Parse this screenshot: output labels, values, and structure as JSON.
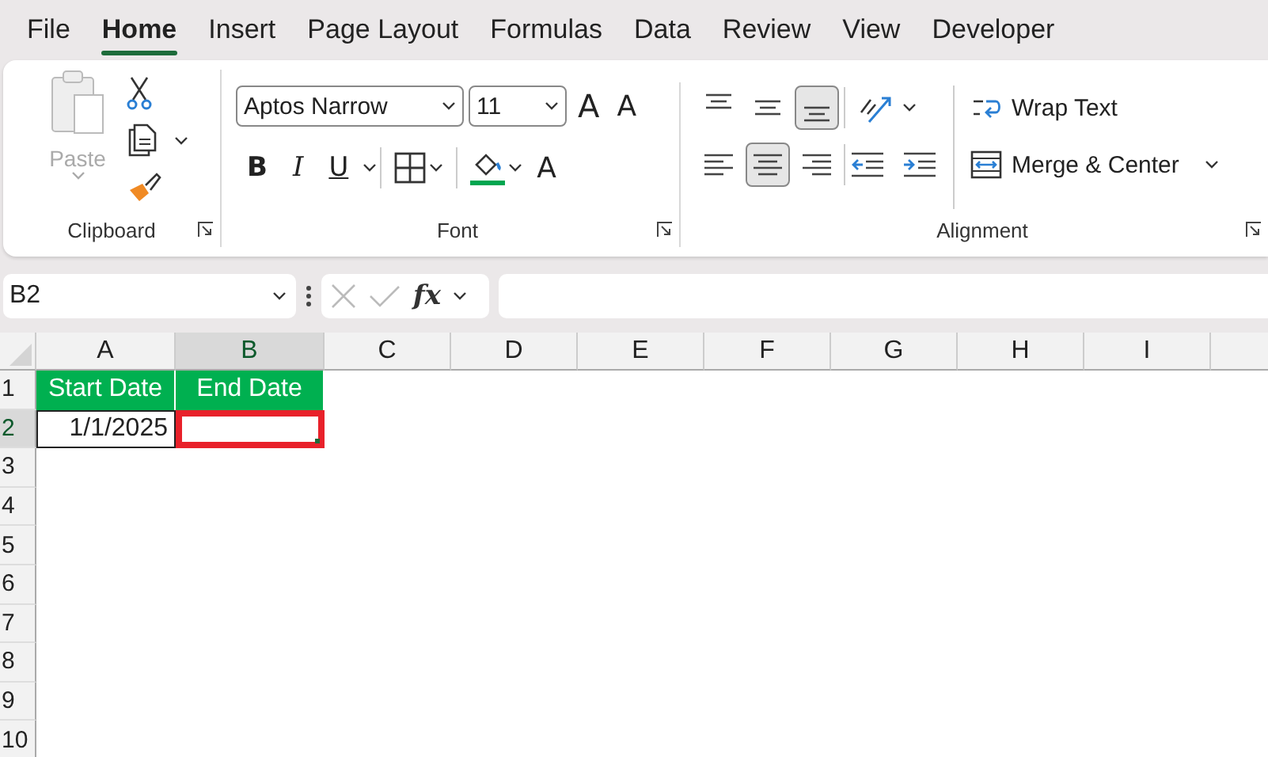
{
  "menu_tabs": [
    {
      "label": "File",
      "selected": false
    },
    {
      "label": "Home",
      "selected": true
    },
    {
      "label": "Insert",
      "selected": false
    },
    {
      "label": "Page Layout",
      "selected": false
    },
    {
      "label": "Formulas",
      "selected": false
    },
    {
      "label": "Data",
      "selected": false
    },
    {
      "label": "Review",
      "selected": false
    },
    {
      "label": "View",
      "selected": false
    },
    {
      "label": "Developer",
      "selected": false
    }
  ],
  "ribbon": {
    "clipboard": {
      "paste_label": "Paste",
      "paste_disabled": true,
      "group_label": "Clipboard"
    },
    "font": {
      "font_name": "Aptos Narrow",
      "font_size": "11",
      "grow_font": "A",
      "shrink_font": "A",
      "bold": "B",
      "italic": "I",
      "underline": "U",
      "font_color": "A",
      "group_label": "Font"
    },
    "alignment": {
      "vertical": [
        {
          "kind": "top",
          "selected": false
        },
        {
          "kind": "middle",
          "selected": false
        },
        {
          "kind": "bottom",
          "selected": true
        }
      ],
      "horizontal": [
        {
          "kind": "left",
          "selected": false
        },
        {
          "kind": "center",
          "selected": true
        },
        {
          "kind": "right",
          "selected": false
        }
      ],
      "wrap_text": "Wrap Text",
      "merge_center": "Merge & Center",
      "group_label": "Alignment"
    }
  },
  "formula_bar": {
    "name_box": "B2",
    "fx": "fx"
  },
  "sheet": {
    "columns": [
      {
        "label": "A",
        "selected": false
      },
      {
        "label": "B",
        "selected": true
      },
      {
        "label": "C",
        "selected": false
      },
      {
        "label": "D",
        "selected": false
      },
      {
        "label": "E",
        "selected": false
      },
      {
        "label": "F",
        "selected": false
      },
      {
        "label": "G",
        "selected": false
      },
      {
        "label": "H",
        "selected": false
      },
      {
        "label": "I",
        "selected": false
      }
    ],
    "rows": [
      {
        "number": "1",
        "selected": false,
        "cells": [
          {
            "kind": "header",
            "text": "Start Date"
          },
          {
            "kind": "header",
            "text": "End Date"
          }
        ]
      },
      {
        "number": "2",
        "selected": true,
        "cells": [
          {
            "kind": "date",
            "text": "1/1/2025"
          },
          {
            "kind": "empty",
            "highlighted": true
          }
        ]
      },
      {
        "number": "3",
        "selected": false,
        "cells": []
      },
      {
        "number": "4",
        "selected": false,
        "cells": []
      },
      {
        "number": "5",
        "selected": false,
        "cells": []
      },
      {
        "number": "6",
        "selected": false,
        "cells": []
      },
      {
        "number": "7",
        "selected": false,
        "cells": []
      },
      {
        "number": "8",
        "selected": false,
        "cells": []
      },
      {
        "number": "9",
        "selected": false,
        "cells": []
      },
      {
        "number": "10",
        "selected": false,
        "cells": []
      }
    ]
  }
}
